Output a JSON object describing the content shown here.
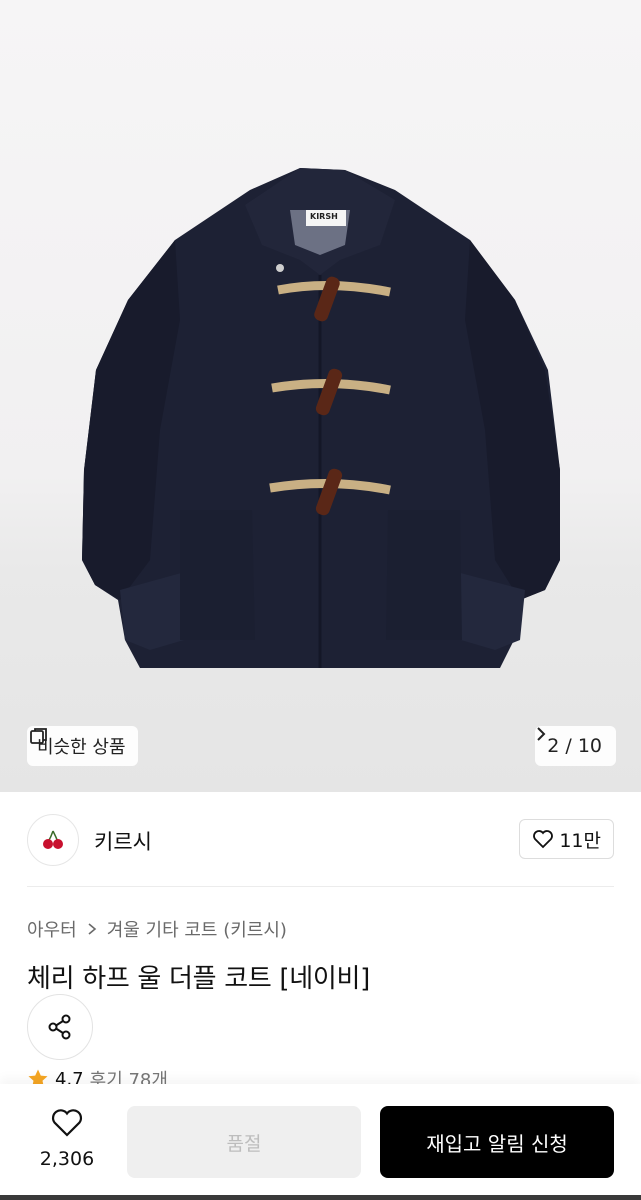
{
  "gallery": {
    "similar_label": "비슷한 상품",
    "pager_text": "2 / 10",
    "jacket_tag": "KIRSH"
  },
  "brand": {
    "name": "키르시",
    "likes": "11만"
  },
  "product": {
    "breadcrumb": [
      "아우터",
      "겨울 기타 코트 (키르시)"
    ],
    "title": "체리 하프 울 더플 코트 [네이비]",
    "rating": "4.7",
    "reviews": "후기 78개"
  },
  "bottom_bar": {
    "wish_count": "2,306",
    "soldout_label": "품절",
    "restock_label": "재입고 알림 신청"
  },
  "colors": {
    "coat_navy": "#1d2134",
    "star": "#f5a623",
    "primary_button": "#000000",
    "disabled_button": "#efefef"
  }
}
